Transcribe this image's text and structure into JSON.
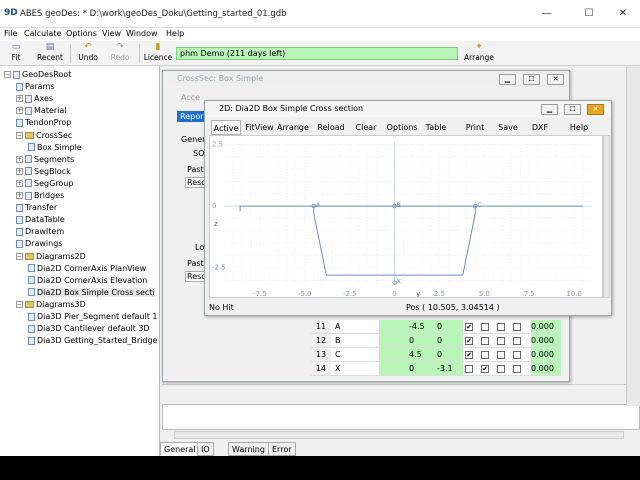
{
  "app": {
    "icon": "9D",
    "title": "ABES geoDes:  * D:\\work\\geoDes_Doku\\Getting_started_01.gdb"
  },
  "window_controls": {
    "minimize": "—",
    "maximize": "☐",
    "close": "✕"
  },
  "menu": [
    "File",
    "Calculate",
    "Options",
    "View",
    "Window",
    "Help"
  ],
  "toolbar": {
    "fit": "Fit",
    "recent": "Recent",
    "undo": "Undo",
    "redo": "Redo",
    "licence": "Licence",
    "arrange": "Arrange",
    "demo_text": "phm Demo (211 days left)",
    "icons": {
      "fit": "fit-icon",
      "recent": "recent-icon",
      "undo": "undo-icon",
      "redo": "redo-icon",
      "licence": "licence-icon",
      "arrange": "arrange-icon"
    }
  },
  "tree": [
    {
      "label": "GeoDesRoot",
      "level": 0,
      "type": "root"
    },
    {
      "label": "Params",
      "level": 1,
      "type": "leaf"
    },
    {
      "label": "Axes",
      "level": 1,
      "type": "collapsed"
    },
    {
      "label": "Material",
      "level": 1,
      "type": "collapsed"
    },
    {
      "label": "TendonProp",
      "level": 1,
      "type": "leaf"
    },
    {
      "label": "CrossSec",
      "level": 1,
      "type": "open"
    },
    {
      "label": "Box Simple",
      "level": 2,
      "type": "leaf"
    },
    {
      "label": "Segments",
      "level": 1,
      "type": "collapsed"
    },
    {
      "label": "SegBlock",
      "level": 1,
      "type": "collapsed"
    },
    {
      "label": "SegGroup",
      "level": 1,
      "type": "collapsed"
    },
    {
      "label": "Bridges",
      "level": 1,
      "type": "collapsed"
    },
    {
      "label": "Transfer",
      "level": 1,
      "type": "leaf"
    },
    {
      "label": "DataTable",
      "level": 1,
      "type": "leaf"
    },
    {
      "label": "DrawItem",
      "level": 1,
      "type": "leaf"
    },
    {
      "label": "Drawings",
      "level": 1,
      "type": "leaf"
    },
    {
      "label": "Diagrams2D",
      "level": 1,
      "type": "open"
    },
    {
      "label": "Dia2D CornerAxis PlanView",
      "level": 2,
      "type": "leaf"
    },
    {
      "label": "Dia2D CornerAxis Elevation",
      "level": 2,
      "type": "leaf"
    },
    {
      "label": "Dia2D Box Simple Cross secti",
      "level": 2,
      "type": "leaf",
      "selected": true
    },
    {
      "label": "Diagrams3D",
      "level": 1,
      "type": "open"
    },
    {
      "label": "Dia3D Pier_Segment default 1",
      "level": 2,
      "type": "leaf"
    },
    {
      "label": "Dia3D Cantilever default 3D",
      "level": 2,
      "type": "leaf"
    },
    {
      "label": "Dia3D Getting_Started_Bridge",
      "level": 2,
      "type": "leaf"
    }
  ],
  "crosssec_window": {
    "title": "CrossSec: Box Simple",
    "accent_label": "Acce",
    "report_tab": "Repor",
    "general_label": "Gener",
    "so_label": "SO",
    "paste_label": "Past",
    "resol_label": "Resol",
    "lo_label": "Lo",
    "paste2_label": "Paste",
    "resol2_label": "Resol"
  },
  "dia_window": {
    "title": "2D: Dia2D Box Simple Cross section",
    "toolbar": [
      "Active",
      "FitView",
      "Arrange",
      "Reload",
      "Clear",
      "Options",
      "Table",
      "Print",
      "Save",
      "DXF",
      "Help"
    ],
    "status_hit": "No Hit",
    "status_pos": "Pos ( 10.505, 3.04514 )"
  },
  "chart_data": {
    "type": "line",
    "title": "",
    "xlabel": "y",
    "ylabel": "z",
    "xlim": [
      -9.5,
      11
    ],
    "ylim": [
      -3.2,
      2.6
    ],
    "x_ticks": [
      -7.5,
      -5.0,
      -2.5,
      0,
      2.5,
      5.0,
      7.5,
      10.0
    ],
    "x_tick_labels": [
      "-7.5",
      "-5.0",
      "-2.5",
      "0",
      "2.5",
      "5.0",
      "7.5",
      "10.0"
    ],
    "y_ticks": [
      2.5,
      0,
      -2.5
    ],
    "y_tick_labels": [
      "2.5",
      "0",
      "-2.5"
    ],
    "grid": true,
    "series": [
      {
        "name": "",
        "x": [
          -8.6,
          10.5,
          4.5,
          4.5,
          3.8,
          -3.8,
          -4.5,
          -4.5,
          -8.6,
          -8.6
        ],
        "y": [
          0.0,
          0.0,
          0.0,
          -0.3,
          -2.8,
          -2.8,
          -0.3,
          0.0,
          0.0,
          -0.2
        ]
      }
    ],
    "points": [
      {
        "label": "A",
        "x": -4.5,
        "y": 0
      },
      {
        "label": "B",
        "x": 0,
        "y": 0
      },
      {
        "label": "C",
        "x": 4.5,
        "y": 0
      },
      {
        "label": "X",
        "x": 0,
        "y": -3.1
      }
    ]
  },
  "table": {
    "rows": [
      {
        "id": "11",
        "name": "A",
        "v1": "-4.5",
        "v2": "0",
        "checks": [
          true,
          false,
          false,
          false
        ],
        "val": "0.000"
      },
      {
        "id": "12",
        "name": "B",
        "v1": "0",
        "v2": "0",
        "checks": [
          true,
          false,
          false,
          false
        ],
        "val": "0.000"
      },
      {
        "id": "13",
        "name": "C",
        "v1": "4.5",
        "v2": "0",
        "checks": [
          true,
          false,
          false,
          false
        ],
        "val": "0.000"
      },
      {
        "id": "14",
        "name": "X",
        "v1": "0",
        "v2": "-3.1",
        "checks": [
          false,
          true,
          false,
          false
        ],
        "val": "0.000"
      }
    ]
  },
  "bottom_tabs": [
    "General",
    "IO",
    "Warning",
    "Error"
  ]
}
